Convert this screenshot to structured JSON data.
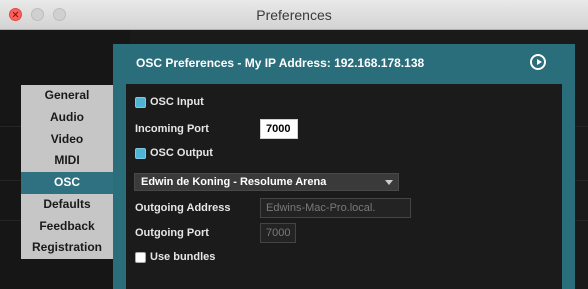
{
  "window": {
    "title": "Preferences"
  },
  "sidebar": {
    "items": [
      {
        "label": "General"
      },
      {
        "label": "Audio"
      },
      {
        "label": "Video"
      },
      {
        "label": "MIDI"
      },
      {
        "label": "OSC",
        "active": true
      },
      {
        "label": "Defaults"
      },
      {
        "label": "Feedback"
      },
      {
        "label": "Registration"
      }
    ]
  },
  "panel": {
    "header": "OSC Preferences - My IP Address: 192.168.178.138",
    "osc_input": {
      "label": "OSC Input",
      "checked": true
    },
    "incoming_port": {
      "label": "Incoming Port",
      "value": "7000"
    },
    "osc_output": {
      "label": "OSC Output",
      "checked": true
    },
    "output_target": {
      "selected": "Edwin de Koning - Resolume Arena"
    },
    "outgoing_address": {
      "label": "Outgoing Address",
      "value": "Edwins-Mac-Pro.local."
    },
    "outgoing_port": {
      "label": "Outgoing Port",
      "value": "7000"
    },
    "use_bundles": {
      "label": "Use bundles",
      "checked": false
    }
  },
  "colors": {
    "accent": "#2a6d7b",
    "checkbox_checked": "#4fb3d3",
    "close_button": "#fc605c"
  },
  "icons": [
    "close-icon",
    "minimize-icon",
    "maximize-icon",
    "play-circle-icon",
    "chevron-down-icon"
  ]
}
